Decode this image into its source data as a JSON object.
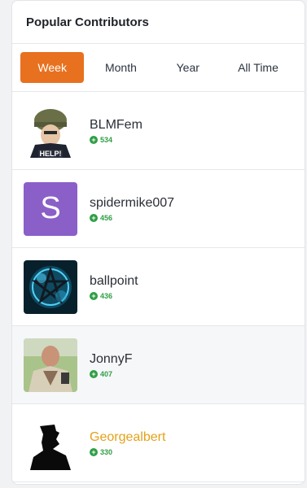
{
  "header": {
    "title": "Popular Contributors"
  },
  "tabs": [
    {
      "label": "Week",
      "active": true
    },
    {
      "label": "Month",
      "active": false
    },
    {
      "label": "Year",
      "active": false
    },
    {
      "label": "All Time",
      "active": false
    }
  ],
  "contributors": [
    {
      "name": "BLMFem",
      "points": "534",
      "avatar_caption": "HELP!"
    },
    {
      "name": "spidermike007",
      "points": "456",
      "avatar_letter": "S"
    },
    {
      "name": "ballpoint",
      "points": "436"
    },
    {
      "name": "JonnyF",
      "points": "407"
    },
    {
      "name": "Georgealbert",
      "points": "330"
    }
  ],
  "colors": {
    "accent": "#e8711f",
    "points_green": "#2f9e44",
    "highlight_name": "#e3a21a",
    "letter_avatar_bg": "#8b5fc8"
  },
  "icons": {
    "points": "plus-circle-icon"
  }
}
